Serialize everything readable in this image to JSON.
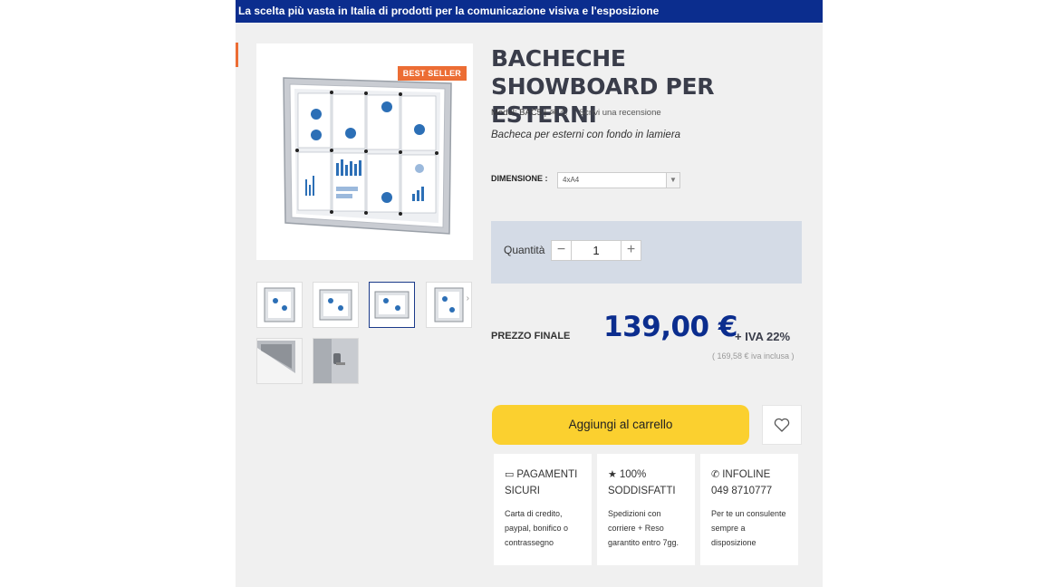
{
  "topbar": {
    "text": "La scelta più vasta in Italia di prodotti per la comunicazione visiva e l'esposizione"
  },
  "product": {
    "badge": "BEST SELLER",
    "title": "BACHECHE SHOWBOARD PER ESTERNI",
    "model": "Model: BAC5 |",
    "review_link": "Scrivi una recensione",
    "subtitle": "Bacheca per esterni con fondo in lamiera"
  },
  "options": {
    "dimension_label": "DIMENSIONE :",
    "dimension_value": "4xA4"
  },
  "quantity": {
    "label": "Quantità",
    "value": "1",
    "minus": "−",
    "plus": "+"
  },
  "price": {
    "label": "PREZZO FINALE",
    "value": "139,00 €",
    "vat": "+ IVA 22%",
    "vat_included": "( 169,58 € iva inclusa )"
  },
  "actions": {
    "add_to_cart": "Aggiungi al carrello"
  },
  "info": [
    {
      "icon": "credit-card-icon",
      "title": "PAGAMENTI SICURI",
      "text": "Carta di credito, paypal, bonifico o contrassegno"
    },
    {
      "icon": "star-icon",
      "title": "100% SODDISFATTI",
      "text": "Spedizioni con corriere + Reso garantito entro 7gg."
    },
    {
      "icon": "phone-icon",
      "title": "INFOLINE 049 8710777",
      "text": "Per te un consulente sempre a disposizione"
    }
  ],
  "colors": {
    "brand_blue": "#0b2d8e",
    "accent_orange": "#ec6d34",
    "cart_yellow": "#fbd02f",
    "qty_bg": "#d4dbe6"
  }
}
